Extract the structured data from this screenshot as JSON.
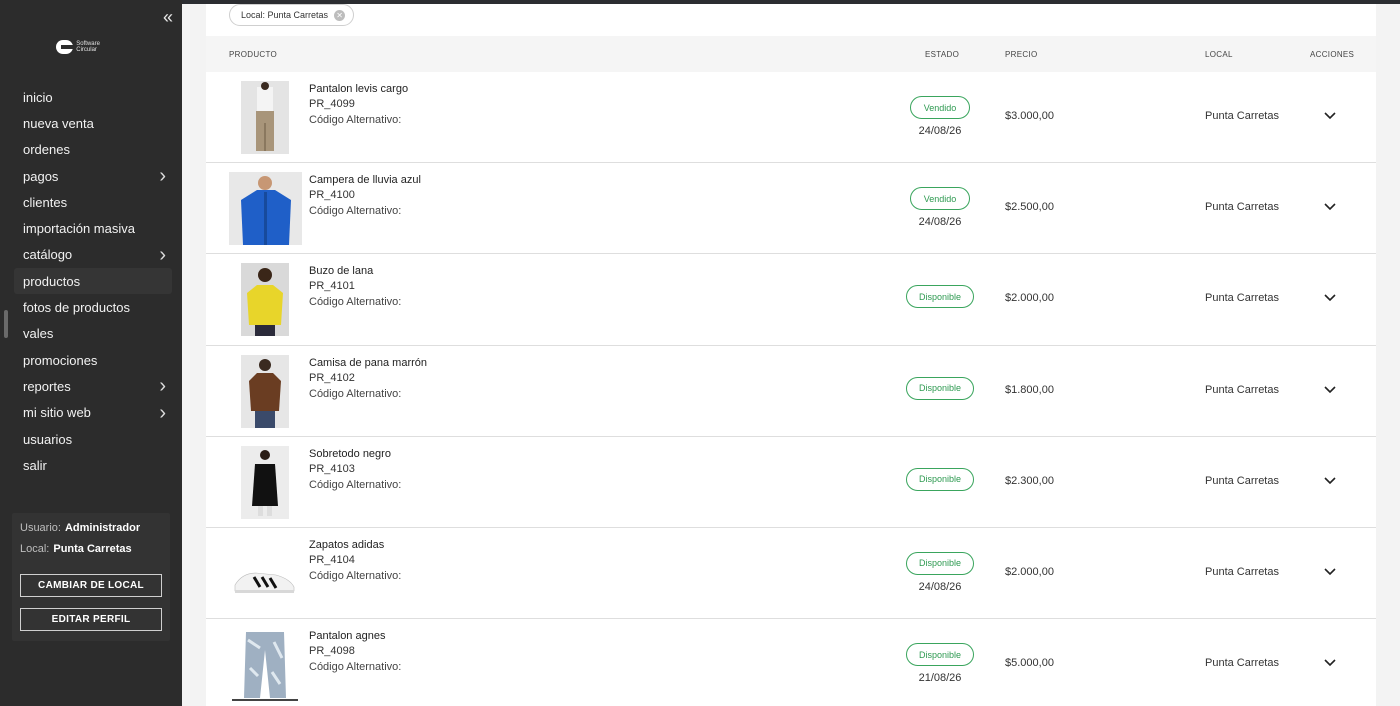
{
  "sidebar": {
    "collapse_icon": "double-chevron-left-icon",
    "logo": "Software Circular",
    "nav": [
      {
        "label": "inicio",
        "chevron": false
      },
      {
        "label": "nueva venta",
        "chevron": false
      },
      {
        "label": "ordenes",
        "chevron": false
      },
      {
        "label": "pagos",
        "chevron": true
      },
      {
        "label": "clientes",
        "chevron": false
      },
      {
        "label": "importación masiva",
        "chevron": false
      },
      {
        "label": "catálogo",
        "chevron": true
      },
      {
        "label": "productos",
        "chevron": false,
        "active": true
      },
      {
        "label": "fotos de productos",
        "chevron": false
      },
      {
        "label": "vales",
        "chevron": false
      },
      {
        "label": "promociones",
        "chevron": false
      },
      {
        "label": "reportes",
        "chevron": true
      },
      {
        "label": "mi sitio web",
        "chevron": true
      },
      {
        "label": "usuarios",
        "chevron": false
      },
      {
        "label": "salir",
        "chevron": false
      }
    ],
    "user_label": "Usuario:",
    "user_value": "Administrador",
    "local_label": "Local:",
    "local_value": "Punta Carretas",
    "change_local_button": "CAMBIAR DE LOCAL",
    "edit_profile_button": "EDITAR PERFIL"
  },
  "filter": {
    "chip_label": "Local: Punta Carretas"
  },
  "table": {
    "headers": {
      "producto": "PRODUCTO",
      "estado": "ESTADO",
      "precio": "PRECIO",
      "local": "LOCAL",
      "acciones": "ACCIONES"
    },
    "alt_label": "Código Alternativo:",
    "rows": [
      {
        "name": "Pantalon levis cargo",
        "code": "PR_4099",
        "status": "Vendido",
        "date": "24/08/26",
        "price": "$3.000,00",
        "local": "Punta Carretas",
        "thumb": "pants-khaki"
      },
      {
        "name": "Campera de lluvia azul",
        "code": "PR_4100",
        "status": "Vendido",
        "date": "24/08/26",
        "price": "$2.500,00",
        "local": "Punta Carretas",
        "thumb": "jacket-blue"
      },
      {
        "name": "Buzo de lana",
        "code": "PR_4101",
        "status": "Disponible",
        "date": "",
        "price": "$2.000,00",
        "local": "Punta Carretas",
        "thumb": "sweater-yellow"
      },
      {
        "name": "Camisa de pana marrón",
        "code": "PR_4102",
        "status": "Disponible",
        "date": "",
        "price": "$1.800,00",
        "local": "Punta Carretas",
        "thumb": "shirt-brown"
      },
      {
        "name": "Sobretodo negro",
        "code": "PR_4103",
        "status": "Disponible",
        "date": "",
        "price": "$2.300,00",
        "local": "Punta Carretas",
        "thumb": "coat-black"
      },
      {
        "name": "Zapatos adidas",
        "code": "PR_4104",
        "status": "Disponible",
        "date": "24/08/26",
        "price": "$2.000,00",
        "local": "Punta Carretas",
        "thumb": "sneaker-white"
      },
      {
        "name": "Pantalon agnes",
        "code": "PR_4098",
        "status": "Disponible",
        "date": "21/08/26",
        "price": "$5.000,00",
        "local": "Punta Carretas",
        "thumb": "pants-patterned"
      }
    ]
  },
  "colors": {
    "sidebar_bg": "#2c2c2c",
    "status_green": "#2e9a51"
  }
}
